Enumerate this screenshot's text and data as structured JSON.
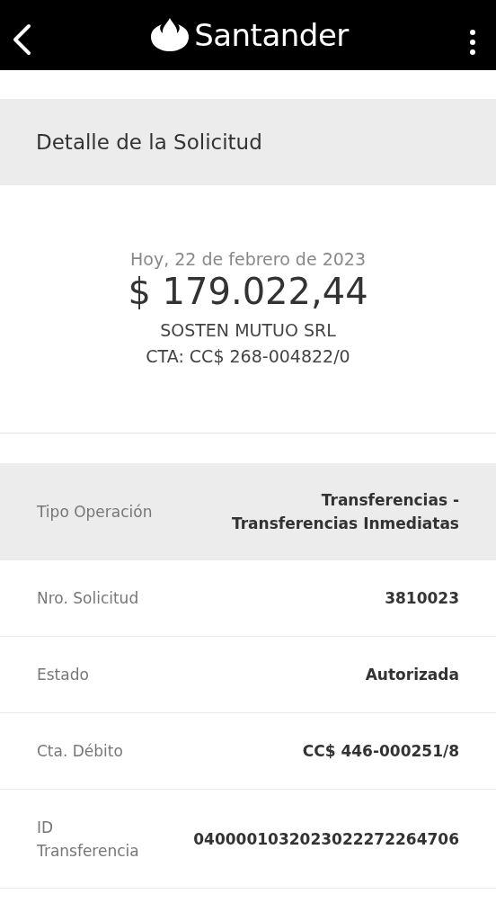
{
  "header": {
    "brand": "Santander"
  },
  "section_title": "Detalle de la Solicitud",
  "summary": {
    "date": "Hoy, 22 de febrero de 2023",
    "amount": "$ 179.022,44",
    "beneficiary": "SOSTEN MUTUO SRL",
    "account": "CTA: CC$ 268-004822/0"
  },
  "details": [
    {
      "label": "Tipo Operación",
      "value": "Transferencias -\nTransferencias Inmediatas",
      "highlighted": true
    },
    {
      "label": "Nro. Solicitud",
      "value": "3810023",
      "highlighted": false
    },
    {
      "label": "Estado",
      "value": "Autorizada",
      "highlighted": false
    },
    {
      "label": "Cta. Débito",
      "value": "CC$ 446-000251/8",
      "highlighted": false
    },
    {
      "label": "ID\nTransferencia",
      "value": "0400001032023022272264706",
      "highlighted": false
    }
  ]
}
